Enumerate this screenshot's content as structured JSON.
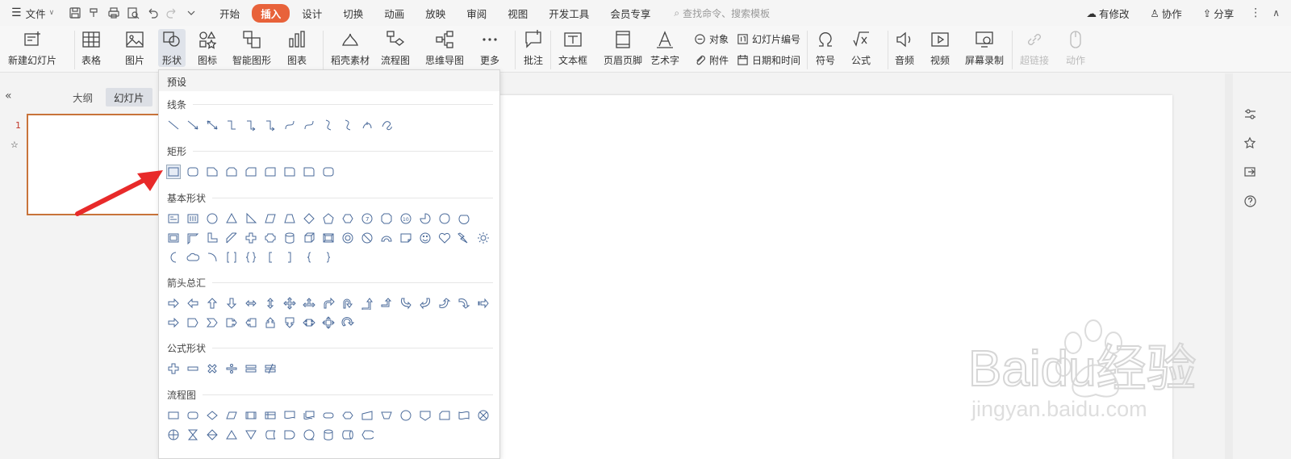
{
  "topbar": {
    "file_menu": "文件",
    "tabs": [
      "开始",
      "插入",
      "设计",
      "切换",
      "动画",
      "放映",
      "审阅",
      "视图",
      "开发工具",
      "会员专享"
    ],
    "active_tab_index": 1,
    "search_placeholder": "查找命令、搜索模板",
    "has_changes": "有修改",
    "collaborate": "协作",
    "share": "分享"
  },
  "ribbon": {
    "new_slide": "新建幻灯片",
    "table": "表格",
    "picture": "图片",
    "shape": "形状",
    "icon": "图标",
    "smart_art": "智能图形",
    "chart": "图表",
    "docer": "稻壳素材",
    "flowchart": "流程图",
    "mindmap": "思维导图",
    "more": "更多",
    "comment": "批注",
    "textbox": "文本框",
    "header_footer": "页眉页脚",
    "wordart": "艺术字",
    "object": "对象",
    "slide_number": "幻灯片编号",
    "attachment": "附件",
    "datetime": "日期和时间",
    "symbol": "符号",
    "formula": "公式",
    "audio": "音频",
    "video": "视频",
    "screen_record": "屏幕录制",
    "hyperlink": "超链接",
    "action": "动作"
  },
  "leftpanel": {
    "outline_tab": "大纲",
    "slides_tab": "幻灯片",
    "slide_number": "1"
  },
  "dropdown": {
    "title": "预设",
    "categories": {
      "lines": "线条",
      "rectangles": "矩形",
      "basic": "基本形状",
      "arrows": "箭头总汇",
      "equation": "公式形状",
      "flowchart": "流程图"
    }
  },
  "watermark": {
    "brand": "Baidu经验",
    "url": "jingyan.baidu.com"
  },
  "colors": {
    "accent": "#e8623a",
    "shape_stroke": "#4a6a9a",
    "arrow": "#e82a2a"
  }
}
